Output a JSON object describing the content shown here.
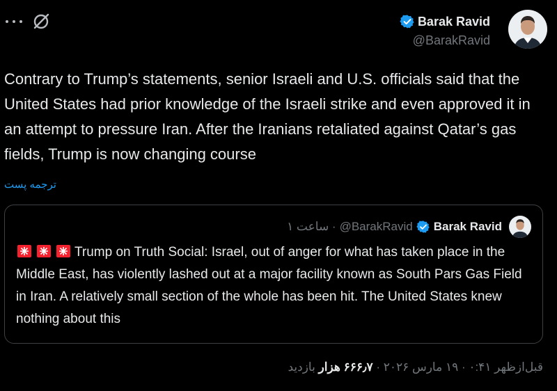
{
  "post": {
    "author_name": "Barak Ravid",
    "author_handle": "@BarakRavid",
    "text": "Contrary to Trump’s statements, senior Israeli and U.S. officials said that the United States had prior knowledge of the Israeli strike and even approved it in an attempt to pressure Iran. After the Iranians retaliated against Qatar’s gas fields, Trump is now changing course",
    "translate_label": "ترجمه پست"
  },
  "quote": {
    "author_name": "Barak Ravid",
    "author_handle": "@BarakRavid",
    "time": "· ساعت ۱",
    "text": "Trump on Truth Social: Israel, out of anger for what has taken place in the Middle East, has violently lashed out at a major facility known as South Pars Gas Field in Iran. A relatively small section of the whole has been hit. The United States knew nothing about this"
  },
  "meta": {
    "datetime": "قبل‌ازظهر ۰:۴۱ · ۱۹ مارس ۲۰۲۶ · ",
    "views_count": "۶۶۶٫۷ هزار",
    "views_label": " بازدید"
  },
  "colors": {
    "accent": "#1d9bf0",
    "background": "#000000",
    "muted": "#71767b",
    "siren": "#f4212e"
  },
  "icons": [
    "more-icon",
    "grok-icon",
    "verified-badge-icon",
    "siren-emoji-icon"
  ]
}
